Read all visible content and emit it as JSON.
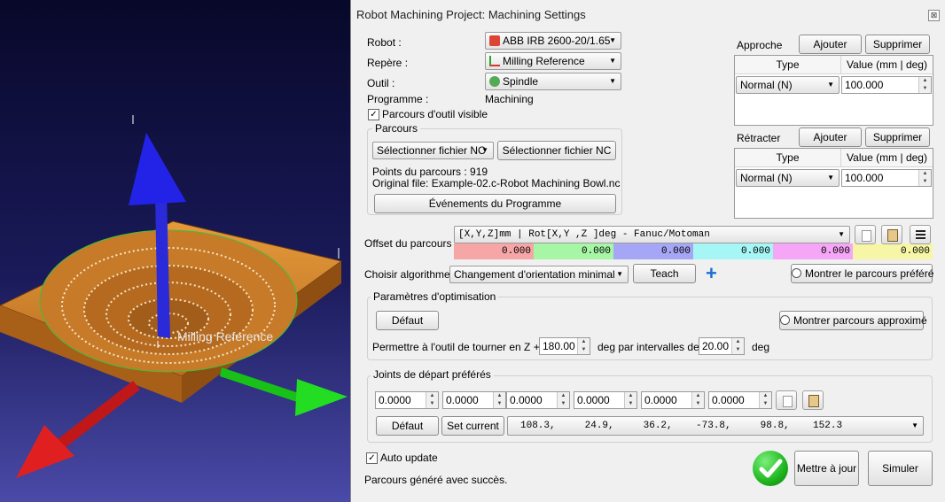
{
  "window": {
    "title": "Robot Machining Project: Machining Settings",
    "close_label": "⊠"
  },
  "viewport": {
    "frame_label": "Milling Reference"
  },
  "robot": {
    "label": "Robot :",
    "value": "ABB IRB 2600-20/1.65"
  },
  "frame": {
    "label": "Repère :",
    "value": "Milling Reference"
  },
  "tool": {
    "label": "Outil :",
    "value": "Spindle"
  },
  "program": {
    "label": "Programme :",
    "value": "Machining"
  },
  "visible_path": {
    "label": "Parcours d'outil visible",
    "checked": true
  },
  "path_group": {
    "title": "Parcours",
    "select_combo": "Sélectionner fichier NC",
    "select_button": "Sélectionner fichier NC",
    "points": "Points du parcours : 919",
    "original_file": "Original file: Example-02.c-Robot Machining Bowl.nc",
    "events_button": "Événements du Programme"
  },
  "approach": {
    "label": "Approche",
    "add": "Ajouter",
    "remove": "Supprimer",
    "col_type": "Type",
    "col_value": "Value (mm | deg)",
    "row_type": "Normal (N)",
    "row_value": "100.000"
  },
  "retract": {
    "label": "Rétracter",
    "add": "Ajouter",
    "remove": "Supprimer",
    "col_type": "Type",
    "col_value": "Value (mm | deg)",
    "row_type": "Normal (N)",
    "row_value": "100.000"
  },
  "offset": {
    "label": "Offset du parcours :",
    "format": "[X,Y,Z]mm | Rot[X,Y ,Z  ]deg - Fanuc/Motoman",
    "values": [
      "0.000",
      "0.000",
      "0.000",
      "0.000",
      "0.000",
      "0.000"
    ],
    "colors": [
      "#f6a6a6",
      "#a6f6a6",
      "#a6a6f6",
      "#a6f6f6",
      "#f6a6f6",
      "#f6f6a6"
    ]
  },
  "algorithm": {
    "label": "Choisir algorithme :",
    "value": "Changement d'orientation minimal",
    "teach": "Teach",
    "show_preferred": "Montrer le parcours préféré"
  },
  "optimization": {
    "title": "Paramètres d'optimisation",
    "default_button": "Défaut",
    "show_approx": "Montrer parcours approximé",
    "rotate_label": "Permettre à l'outil de tourner en Z +/-",
    "rotate_value": "180.00",
    "interval_label": "deg par intervalles de",
    "interval_value": "20.00",
    "unit": "deg"
  },
  "joints": {
    "title": "Joints de départ préférés",
    "values": [
      "0.0000",
      "0.0000",
      "0.0000",
      "0.0000",
      "0.0000",
      "0.0000"
    ],
    "default_button": "Défaut",
    "set_current": "Set current",
    "current": "108.3,     24.9,     36.2,    -73.8,     98.8,    152.3"
  },
  "footer": {
    "auto_update": "Auto update",
    "auto_checked": true,
    "status": "Parcours généré avec succès.",
    "update_button": "Mettre à jour",
    "simulate_button": "Simuler"
  },
  "colors": {
    "success": "#1fb51f",
    "add_icon": "#1a6fd1"
  }
}
